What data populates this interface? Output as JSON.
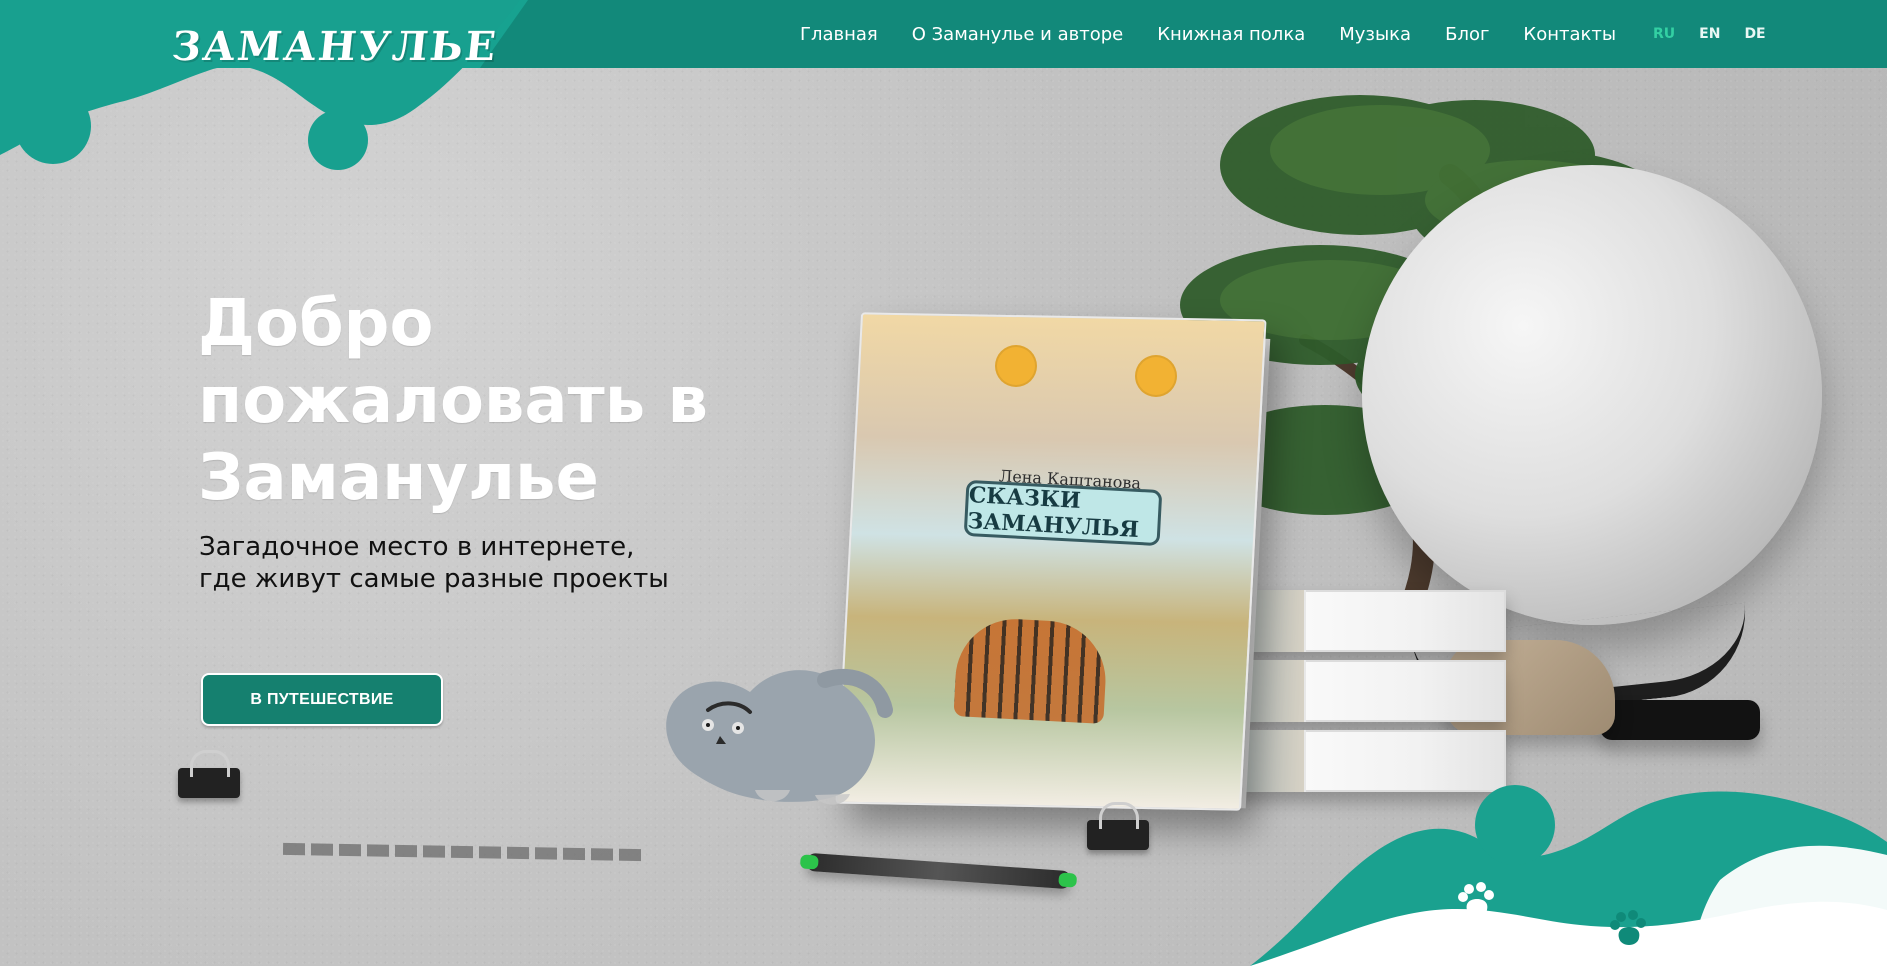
{
  "header": {
    "logo_text": "ЗАМАНУЛЬЕ",
    "nav": [
      {
        "label": "Главная"
      },
      {
        "label": "О Заманулье и авторе"
      },
      {
        "label": "Книжная полка"
      },
      {
        "label": "Музыка"
      },
      {
        "label": "Блог"
      },
      {
        "label": "Контакты"
      }
    ],
    "languages": [
      {
        "label": "RU",
        "active": true
      },
      {
        "label": "EN",
        "active": false
      },
      {
        "label": "DE",
        "active": false
      }
    ]
  },
  "hero": {
    "title": "Добро пожаловать в Заманулье",
    "subtitle": "Загадочное место в интернете, где живут самые разные проекты",
    "cta_label": "В ПУТЕШЕСТВИЕ"
  },
  "book_cover": {
    "author": "Лена Каштанова",
    "title": "СКАЗКИ ЗАМАНУЛЬЯ"
  },
  "colors": {
    "teal_dark": "#12897a",
    "teal_light": "#17a290",
    "accent_green": "#33d0a3",
    "white": "#ffffff"
  },
  "icons": {
    "logo_mark": "manul-cat-logo-icon",
    "paw": "paw-icon"
  }
}
